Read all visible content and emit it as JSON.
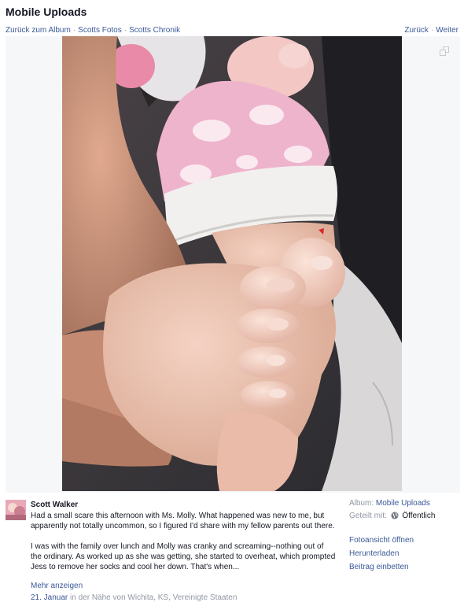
{
  "header": {
    "album_title": "Mobile Uploads",
    "crumbs": [
      "Zurück zum Album",
      "Scotts Fotos",
      "Scotts Chronik"
    ],
    "pager": [
      "Zurück",
      "Weiter"
    ]
  },
  "post": {
    "author": "Scott Walker",
    "paragraphs": [
      "Had a small scare this afternoon with Ms. Molly. What happened was new to me, but apparently not totally uncommon, so I figured I'd share with my fellow parents out there.",
      "I was with the family over lunch and Molly was cranky and screaming--nothing out of the ordinary. As worked up as she was getting, she started to overheat, which prompted Jess to remove her socks and cool her down. That's when..."
    ],
    "more_label": "Mehr anzeigen",
    "date": "21. Januar",
    "location": "in der Nähe von Wichita, KS, Vereinigte Staaten"
  },
  "sidebar": {
    "album_label": "Album:",
    "album_value": "Mobile Uploads",
    "shared_label": "Geteilt mit:",
    "shared_value": "Öffentlich",
    "actions": [
      "Fotoansicht öffnen",
      "Herunterladen",
      "Beitrag einbetten"
    ]
  },
  "icons": {
    "expand": "expand-icon",
    "audience": "globe-icon"
  },
  "colors": {
    "link": "#3b5998",
    "muted": "#9197a3",
    "text": "#141823",
    "stage": "#f6f7f8"
  }
}
